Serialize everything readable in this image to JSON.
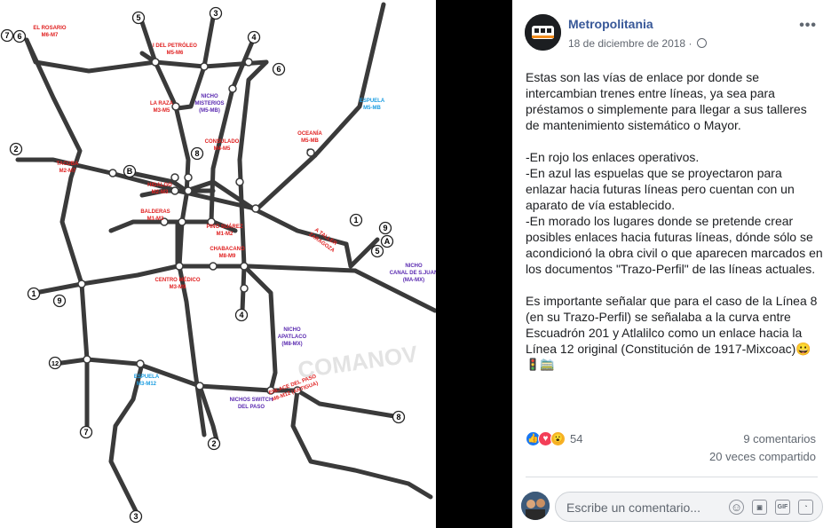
{
  "map": {
    "watermark": "COMANOV",
    "line_numbers": [
      "7",
      "6",
      "5",
      "3",
      "4",
      "6",
      "2",
      "B",
      "8",
      "1",
      "9",
      "A",
      "5",
      "1",
      "9",
      "12",
      "4",
      "7",
      "2",
      "3",
      "8"
    ],
    "labels_red": [
      {
        "lines": [
          "EL ROSARIO",
          "M6-M7"
        ]
      },
      {
        "lines": [
          "I DEL PETRÓLEO",
          "M5-M6"
        ]
      },
      {
        "lines": [
          "LA RAZA",
          "M3-M5"
        ]
      },
      {
        "lines": [
          "CONSULADO",
          "M4-M5"
        ]
      },
      {
        "lines": [
          "OCEANÍA",
          "M5-MB"
        ]
      },
      {
        "lines": [
          "TACUBA",
          "M2-M7"
        ]
      },
      {
        "lines": [
          "HIDALGO",
          "M2-M3"
        ]
      },
      {
        "lines": [
          "BALDERAS",
          "M1-M3"
        ]
      },
      {
        "lines": [
          "PINO SUÁREZ",
          "M1-M2"
        ]
      },
      {
        "lines": [
          "CHABACANO",
          "M8-M9"
        ]
      },
      {
        "lines": [
          "CENTRO MÉDICO",
          "M3-M9"
        ]
      },
      {
        "lines": [
          "A TALLER",
          "ZARAGOZA"
        ]
      },
      {
        "lines": [
          "ENLACE DEL PASO",
          "M8-M12 (ANTIGUA)"
        ]
      }
    ],
    "labels_purple": [
      {
        "lines": [
          "NICHO",
          "MISTERIOS",
          "(M5-MB)"
        ]
      },
      {
        "lines": [
          "NICHO",
          "CANAL DE S.JUAN",
          "(MA-MX)"
        ]
      },
      {
        "lines": [
          "NICHO",
          "APATLACO",
          "(M8-MX)"
        ]
      },
      {
        "lines": [
          "NICHOS SWITCH",
          "DEL PASO"
        ]
      }
    ],
    "labels_blue": [
      {
        "lines": [
          "ESPUELA",
          "M5-MB"
        ]
      },
      {
        "lines": [
          "ESPUELA",
          "M3-M12"
        ]
      }
    ]
  },
  "post": {
    "page_name": "Metropolitania",
    "date": "18 de diciembre de 2018",
    "date_sep": "·",
    "more": "•••",
    "paragraphs": [
      "Estas son las vías de enlace por donde se intercambian trenes entre líneas, ya sea para préstamos o simplemente para llegar a sus talleres de mantenimiento sistemático o Mayor.",
      "-En rojo los enlaces operativos.",
      "-En azul las espuelas que se proyectaron para enlazar hacia futuras líneas pero cuentan con un aparato de vía establecido.",
      "-En morado los lugares donde se pretende crear posibles enlaces hacia futuras líneas, dónde sólo se acondicionó la obra civil o que aparecen marcados en los documentos \"Trazo-Perfil\" de las líneas actuales.",
      "Es importante señalar que para el caso de la Línea 8 (en su Trazo-Perfil) se señalaba a la curva entre Escuadrón 201 y Atlalilco como un enlace hacia la Línea 12 original (Constitución de 1917-Mixcoac)😀"
    ],
    "emoji_line": "🚦🚞",
    "reaction_count": "54",
    "comments": "9 comentarios",
    "shares": "20 veces compartido",
    "comment_placeholder": "Escribe un comentario...",
    "colors": {
      "link": "#385898",
      "like": "#1877f2",
      "love": "#f33e58",
      "wow": "#f7b125"
    }
  }
}
